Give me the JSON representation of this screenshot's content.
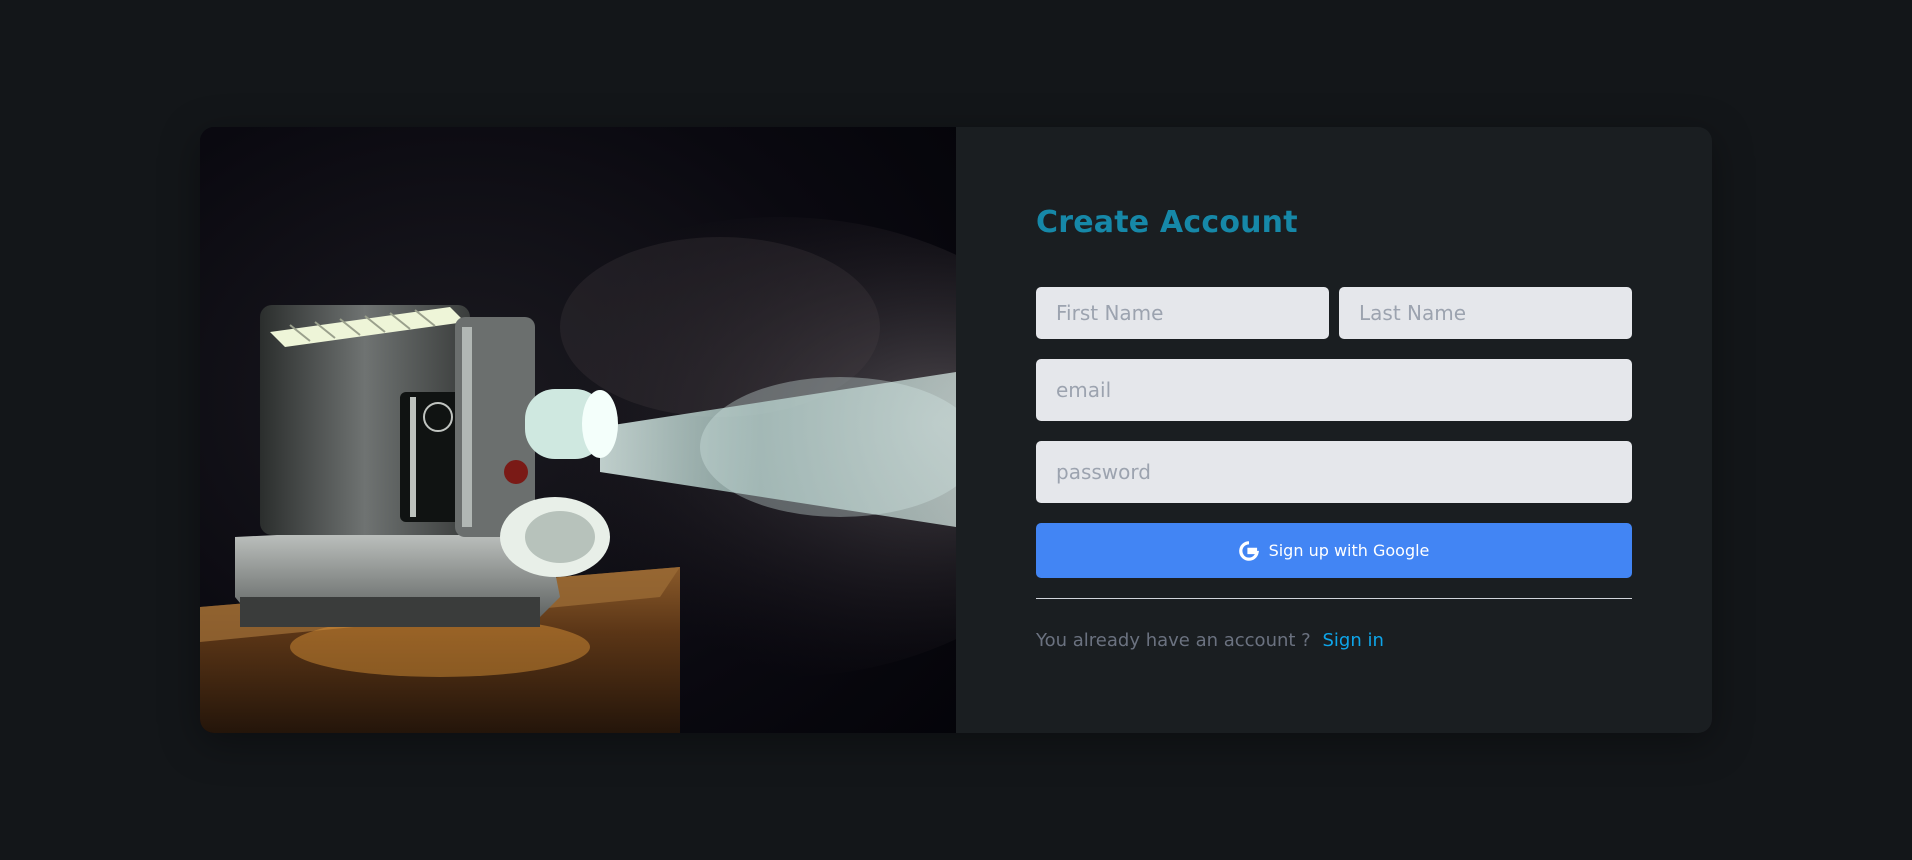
{
  "signup": {
    "title": "Create Account",
    "first_name_placeholder": "First Name",
    "last_name_placeholder": "Last Name",
    "email_placeholder": "email",
    "password_placeholder": "password",
    "google_button_label": "Sign up with Google",
    "google_icon": "google-g-icon",
    "have_account_text": "You already have an account ?",
    "signin_link": "Sign in"
  },
  "colors": {
    "page_background": "#131619",
    "card_background": "#1a1e21",
    "title": "#1688a8",
    "input_background": "#e5e7eb",
    "button": "#4285f4",
    "link": "#0ea5e9"
  }
}
